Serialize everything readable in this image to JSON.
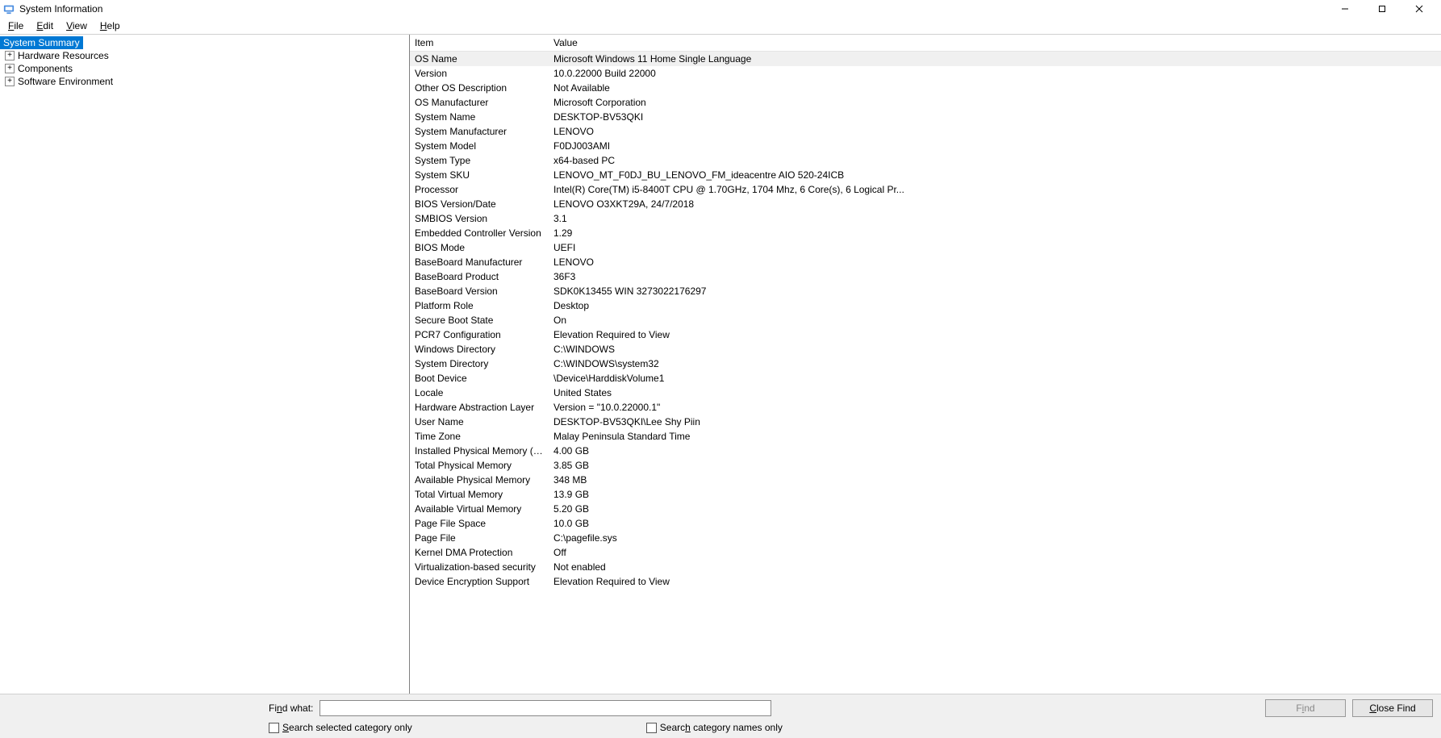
{
  "window": {
    "title": "System Information"
  },
  "menubar": [
    "File",
    "Edit",
    "View",
    "Help"
  ],
  "tree": {
    "root": "System Summary",
    "children": [
      "Hardware Resources",
      "Components",
      "Software Environment"
    ]
  },
  "columns": {
    "item": "Item",
    "value": "Value"
  },
  "rows": [
    {
      "item": "OS Name",
      "value": "Microsoft Windows 11 Home Single Language",
      "selected": true
    },
    {
      "item": "Version",
      "value": "10.0.22000 Build 22000"
    },
    {
      "item": "Other OS Description",
      "value": "Not Available"
    },
    {
      "item": "OS Manufacturer",
      "value": "Microsoft Corporation"
    },
    {
      "item": "System Name",
      "value": "DESKTOP-BV53QKI"
    },
    {
      "item": "System Manufacturer",
      "value": "LENOVO"
    },
    {
      "item": "System Model",
      "value": "F0DJ003AMI"
    },
    {
      "item": "System Type",
      "value": "x64-based PC"
    },
    {
      "item": "System SKU",
      "value": "LENOVO_MT_F0DJ_BU_LENOVO_FM_ideacentre AIO 520-24ICB"
    },
    {
      "item": "Processor",
      "value": "Intel(R) Core(TM) i5-8400T CPU @ 1.70GHz, 1704 Mhz, 6 Core(s), 6 Logical Pr..."
    },
    {
      "item": "BIOS Version/Date",
      "value": "LENOVO O3XKT29A, 24/7/2018"
    },
    {
      "item": "SMBIOS Version",
      "value": "3.1"
    },
    {
      "item": "Embedded Controller Version",
      "value": "1.29"
    },
    {
      "item": "BIOS Mode",
      "value": "UEFI"
    },
    {
      "item": "BaseBoard Manufacturer",
      "value": "LENOVO"
    },
    {
      "item": "BaseBoard Product",
      "value": "36F3"
    },
    {
      "item": "BaseBoard Version",
      "value": "SDK0K13455 WIN 3273022176297"
    },
    {
      "item": "Platform Role",
      "value": "Desktop"
    },
    {
      "item": "Secure Boot State",
      "value": "On"
    },
    {
      "item": "PCR7 Configuration",
      "value": "Elevation Required to View"
    },
    {
      "item": "Windows Directory",
      "value": "C:\\WINDOWS"
    },
    {
      "item": "System Directory",
      "value": "C:\\WINDOWS\\system32"
    },
    {
      "item": "Boot Device",
      "value": "\\Device\\HarddiskVolume1"
    },
    {
      "item": "Locale",
      "value": "United States"
    },
    {
      "item": "Hardware Abstraction Layer",
      "value": "Version = \"10.0.22000.1\""
    },
    {
      "item": "User Name",
      "value": "DESKTOP-BV53QKI\\Lee Shy Piin"
    },
    {
      "item": "Time Zone",
      "value": "Malay Peninsula Standard Time"
    },
    {
      "item": "Installed Physical Memory (RAM)",
      "value": "4.00 GB"
    },
    {
      "item": "Total Physical Memory",
      "value": "3.85 GB"
    },
    {
      "item": "Available Physical Memory",
      "value": "348 MB"
    },
    {
      "item": "Total Virtual Memory",
      "value": "13.9 GB"
    },
    {
      "item": "Available Virtual Memory",
      "value": "5.20 GB"
    },
    {
      "item": "Page File Space",
      "value": "10.0 GB"
    },
    {
      "item": "Page File",
      "value": "C:\\pagefile.sys"
    },
    {
      "item": "Kernel DMA Protection",
      "value": "Off"
    },
    {
      "item": "Virtualization-based security",
      "value": "Not enabled"
    },
    {
      "item": "Device Encryption Support",
      "value": "Elevation Required to View"
    }
  ],
  "findbar": {
    "label": "Find what:",
    "find_button": "Find",
    "close_button": "Close Find",
    "chk_selected": "Search selected category only",
    "chk_names": "Search category names only"
  }
}
